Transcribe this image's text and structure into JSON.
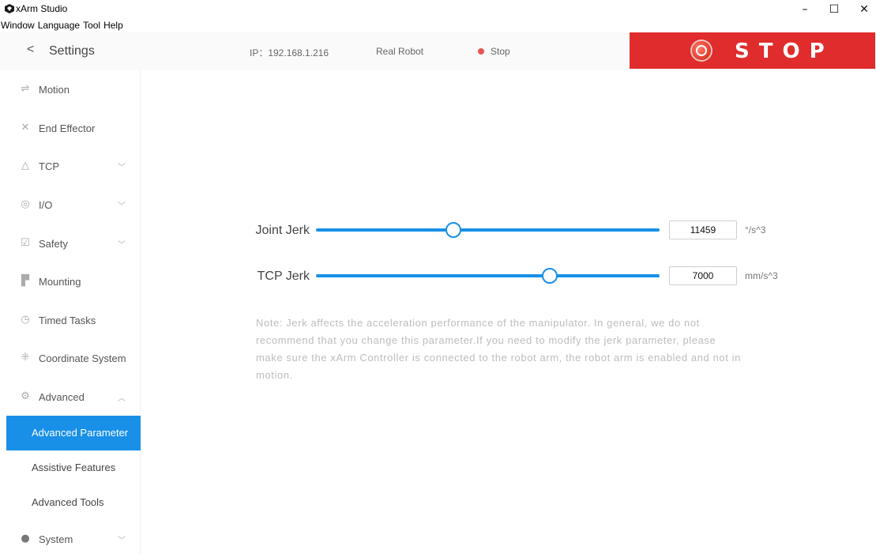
{
  "window": {
    "title": "xArm Studio",
    "controls": {
      "minimize": "–",
      "maximize": "☐",
      "close": "✕"
    }
  },
  "menu": [
    "Window",
    "Language",
    "Tool",
    "Help"
  ],
  "header": {
    "back_icon": "chevron-left-icon",
    "title": "Settings",
    "ip": "IP：192.168.1.216",
    "mode": "Real Robot",
    "state": "Stop",
    "state_color": "#e85454",
    "stop_button": "STOP",
    "stop_color": "#e02c2c"
  },
  "sidebar": {
    "items": [
      {
        "label": "Motion",
        "icon": "motion-icon",
        "chevron": ""
      },
      {
        "label": "End Effector",
        "icon": "tools-icon",
        "chevron": ""
      },
      {
        "label": "TCP",
        "icon": "triangle-icon",
        "chevron": "﹀"
      },
      {
        "label": "I/O",
        "icon": "io-icon",
        "chevron": "﹀"
      },
      {
        "label": "Safety",
        "icon": "shield-check-icon",
        "chevron": "﹀"
      },
      {
        "label": "Mounting",
        "icon": "mounting-icon",
        "chevron": ""
      },
      {
        "label": "Timed Tasks",
        "icon": "clock-icon",
        "chevron": ""
      },
      {
        "label": "Coordinate System",
        "icon": "coordinate-icon",
        "chevron": ""
      },
      {
        "label": "Advanced",
        "icon": "advanced-icon",
        "chevron": "︿"
      }
    ],
    "sub_items": [
      {
        "label": "Advanced Parameter",
        "active": true
      },
      {
        "label": "Assistive Features",
        "active": false
      },
      {
        "label": "Advanced Tools",
        "active": false
      }
    ],
    "last_item": {
      "label": "System",
      "icon": "info-icon",
      "chevron": "﹀"
    },
    "accent_color": "#1890e8"
  },
  "main": {
    "joint_jerk": {
      "label": "Joint Jerk",
      "value": "11459",
      "unit": "°/s^3",
      "slider_fraction": 0.4
    },
    "tcp_jerk": {
      "label": "TCP Jerk",
      "value": "7000",
      "unit": "mm/s^3",
      "slider_fraction": 0.68
    },
    "note": "Note: Jerk affects the acceleration performance of the manipulator. In general, we do not recommend that you change this parameter.If you need to modify the jerk parameter, please make sure the xArm Controller is connected to the robot arm, the robot arm is enabled and not in motion."
  }
}
